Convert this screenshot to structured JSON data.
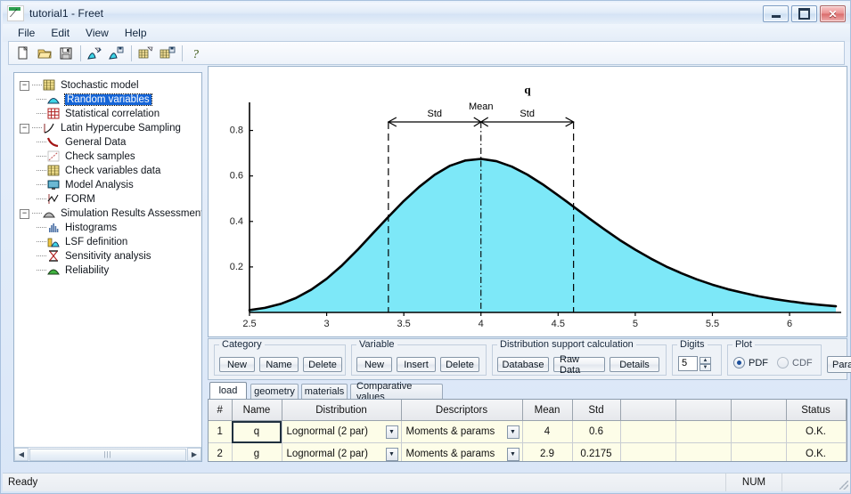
{
  "window": {
    "title": "tutorial1 - Freet",
    "icon": "freet-app-icon",
    "buttons": {
      "minimize": "minimize",
      "maximize": "maximize",
      "close": "close"
    }
  },
  "menu": {
    "items": [
      "File",
      "Edit",
      "View",
      "Help"
    ]
  },
  "toolbar": {
    "items": [
      {
        "name": "new-icon",
        "glyph": "page"
      },
      {
        "name": "open-icon",
        "glyph": "folder"
      },
      {
        "name": "save-icon",
        "glyph": "floppy"
      },
      {
        "name": "separator-1",
        "glyph": "sep"
      },
      {
        "name": "random-variables-icon",
        "glyph": "dist-pen"
      },
      {
        "name": "stochastic-model-icon",
        "glyph": "dist-save"
      },
      {
        "name": "separator-2",
        "glyph": "sep"
      },
      {
        "name": "grid-edit-icon",
        "glyph": "grid-pen"
      },
      {
        "name": "grid-save-icon",
        "glyph": "grid-save"
      },
      {
        "name": "separator-3",
        "glyph": "sep"
      },
      {
        "name": "help-icon",
        "glyph": "question"
      }
    ]
  },
  "tree": {
    "nodes": [
      {
        "label": "Stochastic model",
        "level": 0,
        "expander": "-",
        "icon": "grid-yellow-icon",
        "selected": false
      },
      {
        "label": "Random variables",
        "level": 1,
        "expander": "",
        "icon": "distribution-icon",
        "selected": true
      },
      {
        "label": "Statistical correlation",
        "level": 1,
        "expander": "",
        "icon": "correlation-grid-icon",
        "selected": false
      },
      {
        "label": "Latin Hypercube Sampling",
        "level": 0,
        "expander": "-",
        "icon": "curve-axis-icon",
        "selected": false
      },
      {
        "label": "General Data",
        "level": 1,
        "expander": "",
        "icon": "red-curve-icon",
        "selected": false
      },
      {
        "label": "Check samples",
        "level": 1,
        "expander": "",
        "icon": "scatter-icon",
        "selected": false
      },
      {
        "label": "Check variables data",
        "level": 1,
        "expander": "",
        "icon": "grid-yellow-icon",
        "selected": false
      },
      {
        "label": "Model Analysis",
        "level": 1,
        "expander": "",
        "icon": "monitor-icon",
        "selected": false
      },
      {
        "label": "FORM",
        "level": 1,
        "expander": "",
        "icon": "form-icon",
        "selected": false
      },
      {
        "label": "Simulation Results Assessment",
        "level": 0,
        "expander": "-",
        "icon": "gray-hill-icon",
        "selected": false
      },
      {
        "label": "Histograms",
        "level": 1,
        "expander": "",
        "icon": "histogram-icon",
        "selected": false
      },
      {
        "label": "LSF definition",
        "level": 1,
        "expander": "",
        "icon": "lsf-icon",
        "selected": false
      },
      {
        "label": "Sensitivity analysis",
        "level": 1,
        "expander": "",
        "icon": "hourglass-icon",
        "selected": false
      },
      {
        "label": "Reliability",
        "level": 1,
        "expander": "",
        "icon": "green-hill-icon",
        "selected": false
      }
    ]
  },
  "chart_data": {
    "type": "line",
    "title": "q",
    "xlabel": "",
    "ylabel": "",
    "xlim": [
      2.5,
      6.3
    ],
    "ylim": [
      0,
      0.9
    ],
    "xticks": [
      "2.5",
      "3",
      "3.5",
      "4",
      "4.5",
      "5",
      "5.5",
      "6"
    ],
    "xtick_values": [
      2.5,
      3,
      3.5,
      4,
      4.5,
      5,
      5.5,
      6
    ],
    "yticks": [
      "0.2",
      "0.4",
      "0.6",
      "0.8"
    ],
    "ytick_values": [
      0.2,
      0.4,
      0.6,
      0.8
    ],
    "grid": false,
    "legend": "none",
    "fill_color": "#7DE8F8",
    "line_color": "#000000",
    "distribution": "Lognormal (2 par)",
    "mean": 4,
    "std": 0.6,
    "annotations": [
      {
        "label": "Mean",
        "x": 4.0,
        "type": "vertical-dashdot-line"
      },
      {
        "label": "Std",
        "x_from": 3.4,
        "x_to": 4.0,
        "type": "double-arrow"
      },
      {
        "label": "Std",
        "x_from": 4.0,
        "x_to": 4.6,
        "type": "double-arrow"
      },
      {
        "label": "",
        "x": 3.4,
        "type": "vertical-dashed-line"
      },
      {
        "label": "",
        "x": 4.6,
        "type": "vertical-dashed-line"
      }
    ],
    "x": [
      2.5,
      2.6,
      2.7,
      2.8,
      2.9,
      3.0,
      3.1,
      3.2,
      3.3,
      3.4,
      3.5,
      3.6,
      3.7,
      3.8,
      3.9,
      4.0,
      4.1,
      4.2,
      4.3,
      4.4,
      4.5,
      4.6,
      4.7,
      4.8,
      4.9,
      5.0,
      5.1,
      5.2,
      5.3,
      5.4,
      5.5,
      5.6,
      5.7,
      5.8,
      5.9,
      6.0,
      6.1,
      6.2,
      6.3
    ],
    "y": [
      0.01,
      0.02,
      0.037,
      0.063,
      0.1,
      0.148,
      0.207,
      0.275,
      0.348,
      0.42,
      0.49,
      0.552,
      0.605,
      0.645,
      0.668,
      0.675,
      0.665,
      0.641,
      0.606,
      0.563,
      0.515,
      0.465,
      0.414,
      0.365,
      0.318,
      0.276,
      0.237,
      0.202,
      0.172,
      0.145,
      0.122,
      0.102,
      0.086,
      0.071,
      0.059,
      0.049,
      0.04,
      0.033,
      0.027
    ]
  },
  "controls": {
    "category": {
      "legend": "Category",
      "buttons": [
        "New",
        "Name",
        "Delete"
      ]
    },
    "variable": {
      "legend": "Variable",
      "buttons": [
        "New",
        "Insert",
        "Delete"
      ]
    },
    "distribution_support": {
      "legend": "Distribution support calculation",
      "buttons": [
        "Database",
        "Raw Data",
        "Details"
      ]
    },
    "digits": {
      "legend": "Digits",
      "value": "5"
    },
    "plot": {
      "legend": "Plot",
      "options": [
        "PDF",
        "CDF"
      ],
      "selected": "PDF"
    },
    "param_button": "Param"
  },
  "tabs": {
    "items": [
      "load",
      "geometry",
      "materials",
      "Comparative values"
    ],
    "active": "load"
  },
  "table": {
    "columns": [
      "#",
      "Name",
      "Distribution",
      "Descriptors",
      "Mean",
      "Std",
      "",
      "",
      "",
      "Status"
    ],
    "rows": [
      {
        "index": "1",
        "name": "q",
        "distribution": "Lognormal (2 par)",
        "descriptors": "Moments & params",
        "mean": "4",
        "std": "0.6",
        "c7": "",
        "c8": "",
        "c9": "",
        "status": "O.K."
      },
      {
        "index": "2",
        "name": "g",
        "distribution": "Lognormal (2 par)",
        "descriptors": "Moments & params",
        "mean": "2.9",
        "std": "0.2175",
        "c7": "",
        "c8": "",
        "c9": "",
        "status": "O.K."
      }
    ]
  },
  "statusbar": {
    "message": "Ready",
    "num_indicator": "NUM"
  },
  "colors": {
    "chart_fill": "#7DE8F8",
    "selection_blue": "#1565D8",
    "status_ok": "#14661F",
    "cell_yellow": "#FDFDE8"
  }
}
